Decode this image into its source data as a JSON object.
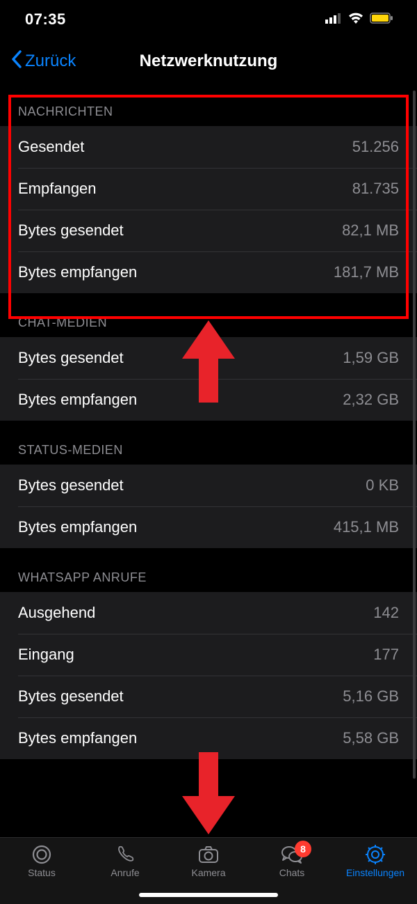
{
  "statusBar": {
    "time": "07:35"
  },
  "nav": {
    "back": "Zurück",
    "title": "Netzwerknutzung"
  },
  "sections": {
    "nachrichten": {
      "header": "NACHRICHTEN",
      "gesendet_label": "Gesendet",
      "gesendet_value": "51.256",
      "empfangen_label": "Empfangen",
      "empfangen_value": "81.735",
      "bytes_gesendet_label": "Bytes gesendet",
      "bytes_gesendet_value": "82,1 MB",
      "bytes_empfangen_label": "Bytes empfangen",
      "bytes_empfangen_value": "181,7 MB"
    },
    "chatmedien": {
      "header": "CHAT-MEDIEN",
      "bytes_gesendet_label": "Bytes gesendet",
      "bytes_gesendet_value": "1,59 GB",
      "bytes_empfangen_label": "Bytes empfangen",
      "bytes_empfangen_value": "2,32 GB"
    },
    "statusmedien": {
      "header": "STATUS-MEDIEN",
      "bytes_gesendet_label": "Bytes gesendet",
      "bytes_gesendet_value": "0 KB",
      "bytes_empfangen_label": "Bytes empfangen",
      "bytes_empfangen_value": "415,1 MB"
    },
    "anrufe": {
      "header": "WHATSAPP ANRUFE",
      "ausgehend_label": "Ausgehend",
      "ausgehend_value": "142",
      "eingang_label": "Eingang",
      "eingang_value": "177",
      "bytes_gesendet_label": "Bytes gesendet",
      "bytes_gesendet_value": "5,16 GB",
      "bytes_empfangen_label": "Bytes empfangen",
      "bytes_empfangen_value": "5,58 GB"
    }
  },
  "tabs": {
    "status": "Status",
    "anrufe": "Anrufe",
    "kamera": "Kamera",
    "chats": "Chats",
    "chats_badge": "8",
    "einstellungen": "Einstellungen"
  }
}
